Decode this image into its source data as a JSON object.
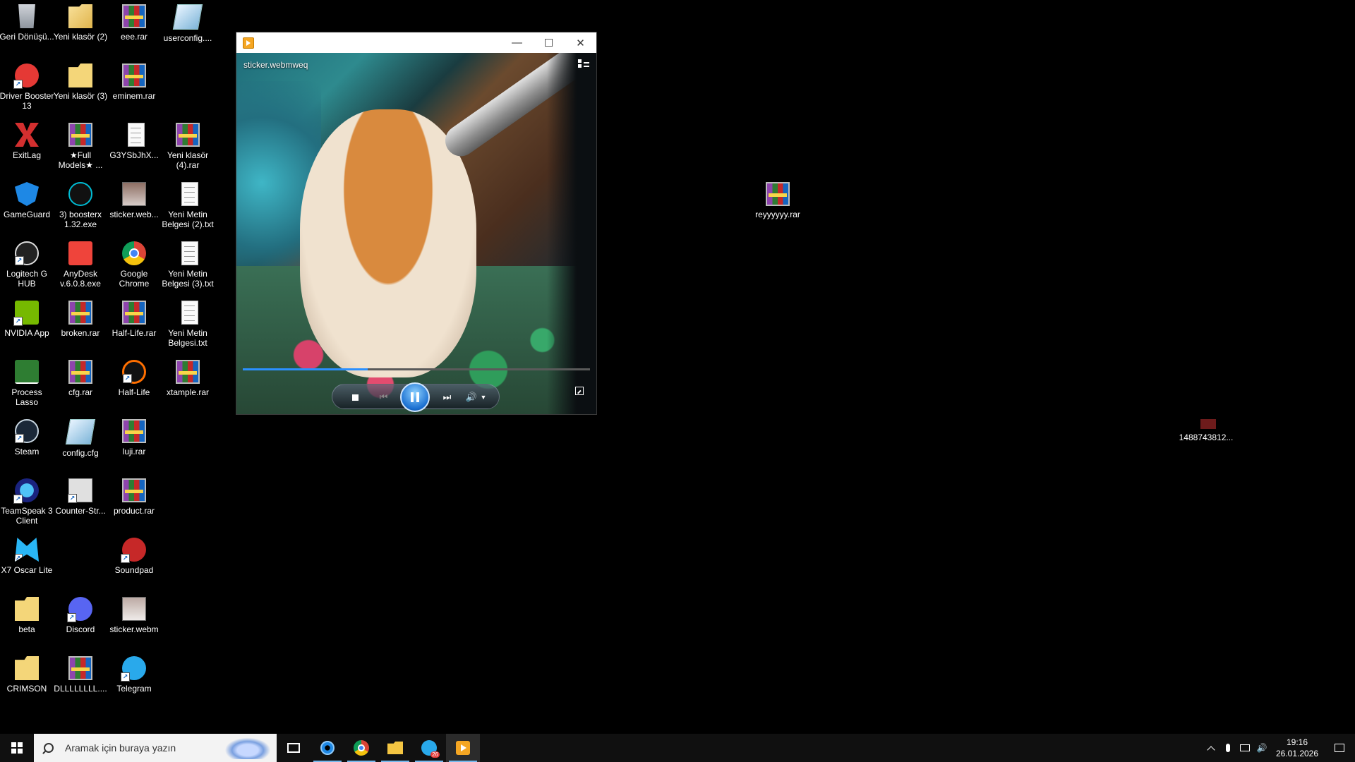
{
  "desktop": {
    "icons": [
      {
        "label": "Geri Dönüşü...",
        "icon": "recycle-bin-icon"
      },
      {
        "label": "Yeni klasör (2)",
        "icon": "folder-icon"
      },
      {
        "label": "eee.rar",
        "icon": "winrar-archive-icon"
      },
      {
        "label": "userconfig....",
        "icon": "config-file-icon"
      },
      {
        "label": "Driver Booster 13",
        "icon": "driver-booster-icon"
      },
      {
        "label": "Yeni klasör (3)",
        "icon": "folder-icon"
      },
      {
        "label": "eminem.rar",
        "icon": "winrar-archive-icon"
      },
      {
        "label": "ExitLag",
        "icon": "exitlag-icon"
      },
      {
        "label": "★Full Models★ ...",
        "icon": "winrar-archive-icon"
      },
      {
        "label": "G3YSbJhX...",
        "icon": "text-file-icon"
      },
      {
        "label": "Yeni klasör (4).rar",
        "icon": "winrar-archive-icon"
      },
      {
        "label": "GameGuard",
        "icon": "gameguard-icon"
      },
      {
        "label": "3) boosterx 1.32.exe",
        "icon": "boosterx-icon"
      },
      {
        "label": "sticker.web...",
        "icon": "image-thumbnail-icon"
      },
      {
        "label": "Yeni Metin Belgesi (2).txt",
        "icon": "text-file-icon"
      },
      {
        "label": "Logitech G HUB",
        "icon": "logitech-icon"
      },
      {
        "label": "AnyDesk v.6.0.8.exe",
        "icon": "anydesk-icon"
      },
      {
        "label": "Google Chrome",
        "icon": "chrome-icon"
      },
      {
        "label": "Yeni Metin Belgesi (3).txt",
        "icon": "text-file-icon"
      },
      {
        "label": "NVIDIA App",
        "icon": "nvidia-icon"
      },
      {
        "label": "broken.rar",
        "icon": "winrar-archive-icon"
      },
      {
        "label": "Half-Life.rar",
        "icon": "winrar-archive-icon"
      },
      {
        "label": "Yeni Metin Belgesi.txt",
        "icon": "text-file-icon"
      },
      {
        "label": "Process Lasso",
        "icon": "process-lasso-icon"
      },
      {
        "label": "cfg.rar",
        "icon": "winrar-archive-icon"
      },
      {
        "label": "Half-Life",
        "icon": "half-life-icon"
      },
      {
        "label": "xtample.rar",
        "icon": "winrar-archive-icon"
      },
      {
        "label": "Steam",
        "icon": "steam-icon"
      },
      {
        "label": "config.cfg",
        "icon": "config-file-icon"
      },
      {
        "label": "luji.rar",
        "icon": "winrar-archive-icon"
      },
      {
        "label": "TeamSpeak 3 Client",
        "icon": "teamspeak-icon"
      },
      {
        "label": "Counter-Str...",
        "icon": "counter-strike-icon"
      },
      {
        "label": "product.rar",
        "icon": "winrar-archive-icon"
      },
      {
        "label": "X7 Oscar Lite",
        "icon": "x7-oscar-icon"
      },
      {
        "label": "Soundpad",
        "icon": "soundpad-icon"
      },
      {
        "label": "beta",
        "icon": "folder-icon"
      },
      {
        "label": "Discord",
        "icon": "discord-icon"
      },
      {
        "label": "sticker.webm",
        "icon": "video-thumbnail-icon"
      },
      {
        "label": "CRIMSON",
        "icon": "folder-icon"
      },
      {
        "label": "DLLLLLLLL....",
        "icon": "winrar-archive-icon"
      },
      {
        "label": "Telegram",
        "icon": "telegram-icon"
      },
      {
        "label": "reyyyyyy.rar",
        "icon": "winrar-archive-icon"
      },
      {
        "label": "1488743812...",
        "icon": "image-file-icon"
      }
    ]
  },
  "player": {
    "window_title": "",
    "video_title": "sticker.webmweq",
    "progress": 0.36,
    "minimize_glyph": "—",
    "maximize_glyph": "☐",
    "close_glyph": "✕",
    "prev_glyph": "⏮",
    "next_glyph": "⏭",
    "volume_glyph": "🔊",
    "volume_dropdown_glyph": "▼"
  },
  "taskbar": {
    "search_placeholder": "Aramak için buraya yazın",
    "telegram_badge": "26",
    "time": "19:16",
    "date": "26.01.2026",
    "volume_glyph": "🔊"
  }
}
